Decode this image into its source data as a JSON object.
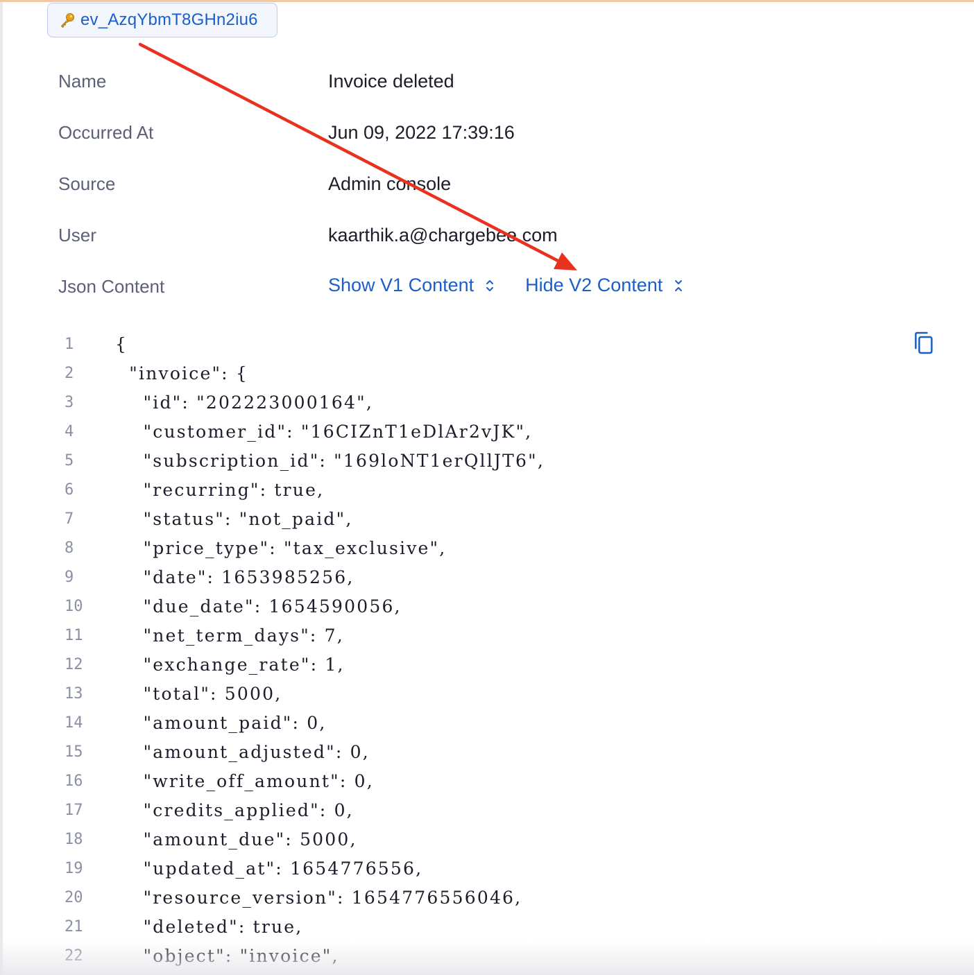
{
  "event": {
    "id": "ev_AzqYbmT8GHn2iu6",
    "icon": "key-icon"
  },
  "details": [
    {
      "label": "Name",
      "value": "Invoice deleted"
    },
    {
      "label": "Occurred At",
      "value": "Jun 09, 2022 17:39:16"
    },
    {
      "label": "Source",
      "value": "Admin console"
    },
    {
      "label": "User",
      "value": "kaarthik.a@chargebee.com"
    }
  ],
  "json_content": {
    "label": "Json Content",
    "show_v1": "Show V1 Content",
    "hide_v2": "Hide V2 Content"
  },
  "code_lines": [
    {
      "n": "1",
      "text": "{"
    },
    {
      "n": "2",
      "text": "  \"invoice\": {"
    },
    {
      "n": "3",
      "text": "    \"id\": \"202223000164\","
    },
    {
      "n": "4",
      "text": "    \"customer_id\": \"16CIZnT1eDlAr2vJK\","
    },
    {
      "n": "5",
      "text": "    \"subscription_id\": \"169loNT1erQllJT6\","
    },
    {
      "n": "6",
      "text": "    \"recurring\": true,"
    },
    {
      "n": "7",
      "text": "    \"status\": \"not_paid\","
    },
    {
      "n": "8",
      "text": "    \"price_type\": \"tax_exclusive\","
    },
    {
      "n": "9",
      "text": "    \"date\": 1653985256,"
    },
    {
      "n": "10",
      "text": "    \"due_date\": 1654590056,"
    },
    {
      "n": "11",
      "text": "    \"net_term_days\": 7,"
    },
    {
      "n": "12",
      "text": "    \"exchange_rate\": 1,"
    },
    {
      "n": "13",
      "text": "    \"total\": 5000,"
    },
    {
      "n": "14",
      "text": "    \"amount_paid\": 0,"
    },
    {
      "n": "15",
      "text": "    \"amount_adjusted\": 0,"
    },
    {
      "n": "16",
      "text": "    \"write_off_amount\": 0,"
    },
    {
      "n": "17",
      "text": "    \"credits_applied\": 0,"
    },
    {
      "n": "18",
      "text": "    \"amount_due\": 5000,"
    },
    {
      "n": "19",
      "text": "    \"updated_at\": 1654776556,"
    },
    {
      "n": "20",
      "text": "    \"resource_version\": 1654776556046,"
    },
    {
      "n": "21",
      "text": "    \"deleted\": true,"
    },
    {
      "n": "22",
      "text": "    \"object\": \"invoice\","
    }
  ],
  "colors": {
    "link": "#1a5fc8",
    "label": "#5b6179",
    "annotation_arrow": "#e8321f"
  }
}
